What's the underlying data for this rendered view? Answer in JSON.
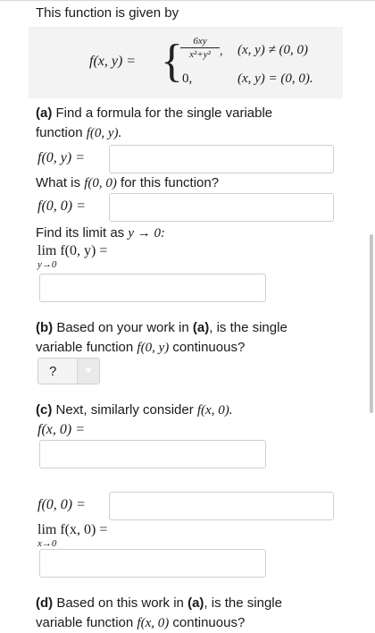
{
  "intro": "This function is given by",
  "definition": {
    "lhs": "f(x, y) =",
    "numerator": "6xy",
    "denominator": "x²+y²",
    "comma": ",",
    "zero": "0,",
    "condition_1": "(x, y) ≠ (0, 0)",
    "condition_2": "(x, y) = (0, 0)."
  },
  "part_a": {
    "tag": "(a)",
    "text_1": " Find a formula for the single variable",
    "text_2": "function ",
    "text_2_math": "f(0, y).",
    "f0y_label": "f(0, y) =",
    "question": "What is ",
    "question_math": "f(0, 0)",
    "question_end": " for this function?",
    "f00_label": "f(0, 0) =",
    "limit_prompt": "Find its limit as ",
    "limit_prompt_math": "y → 0:",
    "lim_label": "lim f(0, y) =",
    "lim_sub": "y→0"
  },
  "part_b": {
    "tag": "(b)",
    "text_1": " Based on your work in ",
    "text_1_bold": "(a)",
    "text_1_end": ", is the single",
    "text_2": "variable function ",
    "text_2_math": "f(0, y)",
    "text_2_end": " continuous?",
    "select_value": "?"
  },
  "part_c": {
    "tag": "(c)",
    "text": " Next, similarly consider ",
    "text_math": "f(x, 0).",
    "fx0_label": "f(x, 0) =",
    "f00_label": "f(0, 0) =",
    "lim_label": "lim f(x, 0) =",
    "lim_sub": "x→0"
  },
  "part_d": {
    "tag": "(d)",
    "text_1": " Based on this work in ",
    "text_1_bold": "(a)",
    "text_1_end": ", is the single",
    "text_2": "variable function ",
    "text_2_math": "f(x, 0)",
    "text_2_end": " continuous?"
  }
}
